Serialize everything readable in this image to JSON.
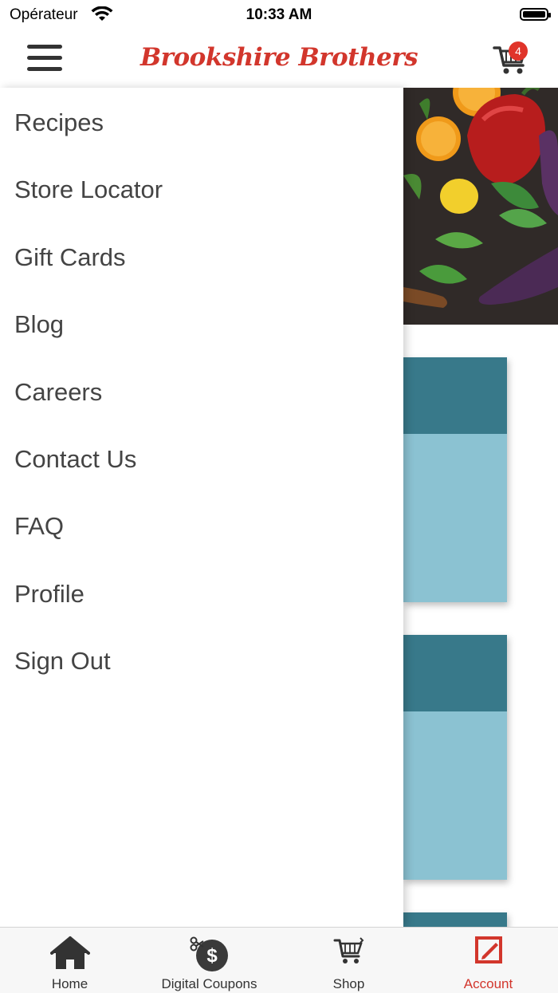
{
  "status_bar": {
    "carrier": "Opérateur",
    "time": "10:33 AM"
  },
  "header": {
    "logo_text": "Brookshire Brothers",
    "cart_count": "4",
    "menu_icon": "hamburger-menu-icon",
    "cart_icon": "shopping-cart-icon",
    "brand_color": "#d2362c"
  },
  "drawer": {
    "items": [
      {
        "label": "Recipes"
      },
      {
        "label": "Store Locator"
      },
      {
        "label": "Gift Cards"
      },
      {
        "label": "Blog"
      },
      {
        "label": "Careers"
      },
      {
        "label": "Contact Us"
      },
      {
        "label": "FAQ"
      },
      {
        "label": "Profile"
      },
      {
        "label": "Sign Out"
      }
    ]
  },
  "tab_bar": {
    "active_color": "#d2362c",
    "tabs": [
      {
        "label": "Home",
        "icon": "home-icon"
      },
      {
        "label": "Digital Coupons",
        "icon": "coupon-dollar-icon"
      },
      {
        "label": "Shop",
        "icon": "shopping-cart-icon"
      },
      {
        "label": "Account",
        "icon": "account-edit-icon",
        "active": true
      }
    ]
  }
}
